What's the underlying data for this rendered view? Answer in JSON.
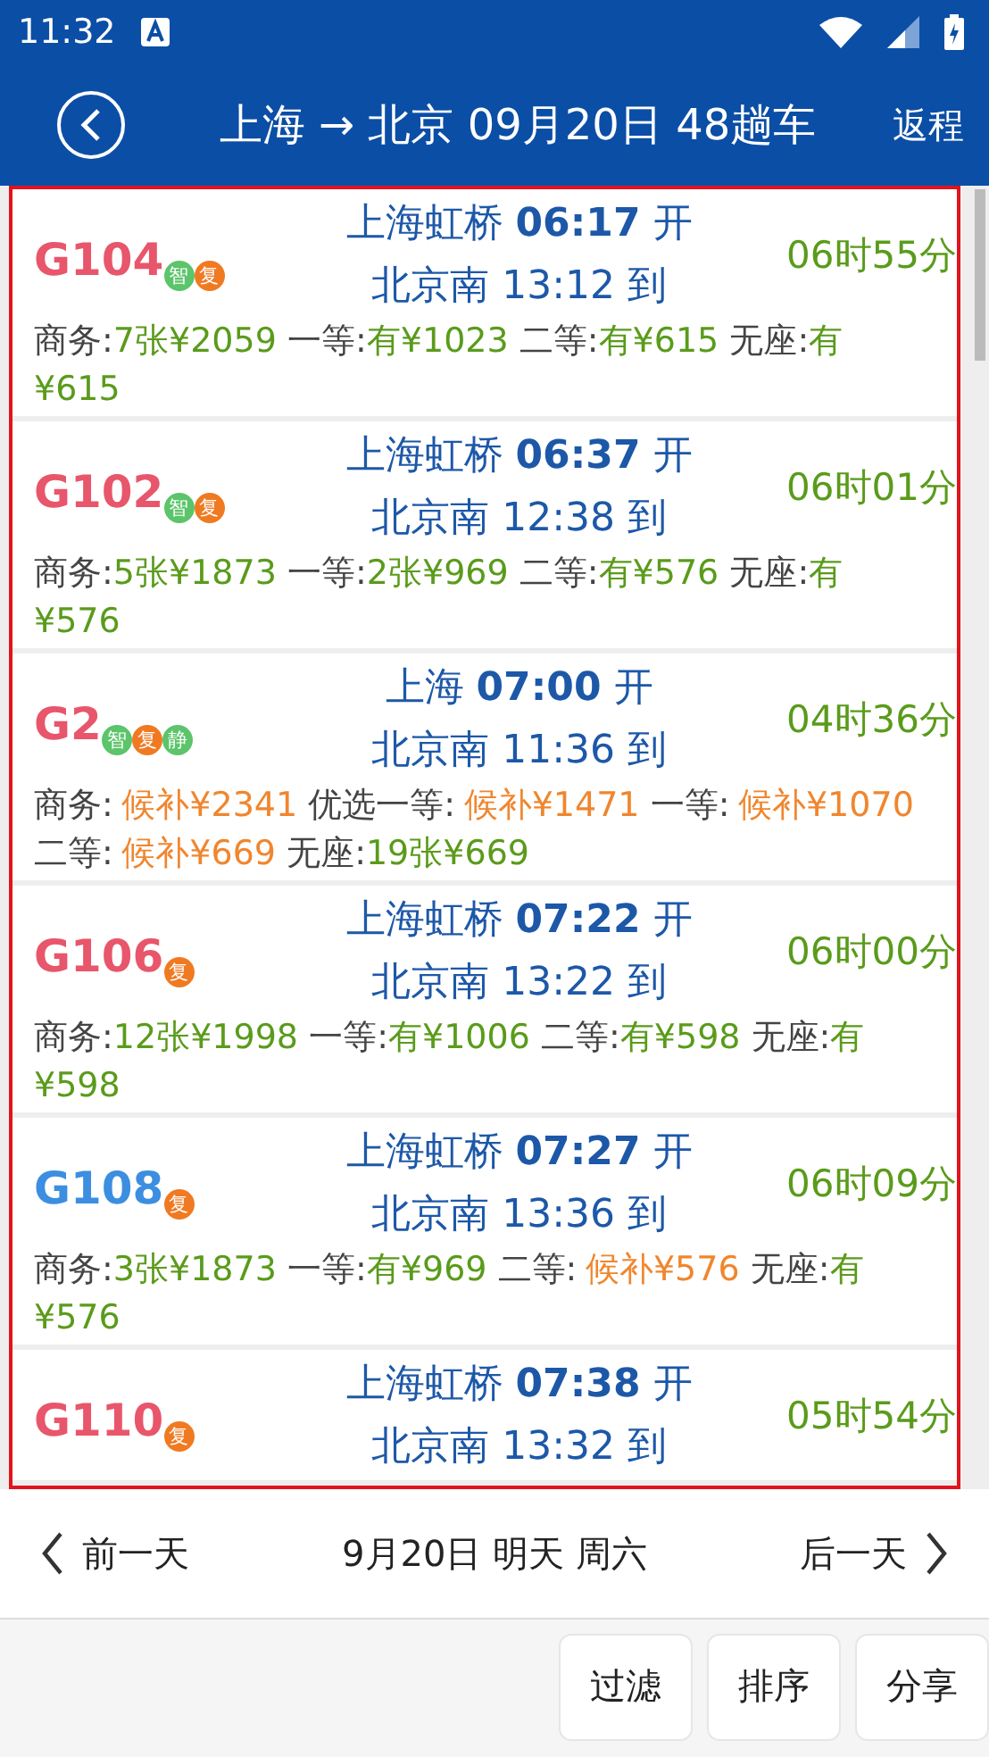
{
  "status_bar": {
    "time": "11:32"
  },
  "header": {
    "title": "上海 → 北京 09月20日 48趟车",
    "return_button": "返程"
  },
  "trains": [
    {
      "code": "G104",
      "color": "#e8566c",
      "badges": [
        {
          "label": "智",
          "color": "#5cc46a"
        },
        {
          "label": "复",
          "color": "#f07a22"
        }
      ],
      "depart": "上海虹桥 **06:17** 开",
      "arrive": "北京南 13:12 到",
      "duration": "06时55分",
      "seats": [
        {
          "label": "商务:",
          "value": "7张¥2059",
          "waitlist": false
        },
        {
          "label": "一等:",
          "value": "有¥1023",
          "waitlist": false
        },
        {
          "label": "二等:",
          "value": "有¥615",
          "waitlist": false
        },
        {
          "label": "无座:",
          "value": "有¥615",
          "waitlist": false
        }
      ]
    },
    {
      "code": "G102",
      "color": "#e8566c",
      "badges": [
        {
          "label": "智",
          "color": "#5cc46a"
        },
        {
          "label": "复",
          "color": "#f07a22"
        }
      ],
      "depart": "上海虹桥 **06:37** 开",
      "arrive": "北京南 12:38 到",
      "duration": "06时01分",
      "seats": [
        {
          "label": "商务:",
          "value": "5张¥1873",
          "waitlist": false
        },
        {
          "label": "一等:",
          "value": "2张¥969",
          "waitlist": false
        },
        {
          "label": "二等:",
          "value": "有¥576",
          "waitlist": false
        },
        {
          "label": "无座:",
          "value": "有¥576",
          "waitlist": false
        }
      ]
    },
    {
      "code": "G2",
      "color": "#e8566c",
      "badges": [
        {
          "label": "智",
          "color": "#5cc46a"
        },
        {
          "label": "复",
          "color": "#f07a22"
        },
        {
          "label": "静",
          "color": "#5cc46a"
        }
      ],
      "depart": "上海 **07:00** 开",
      "arrive": "北京南 11:36 到",
      "duration": "04时36分",
      "seats": [
        {
          "label": "商务:",
          "value": "候补¥2341",
          "waitlist": true
        },
        {
          "label": "优选一等:",
          "value": "候补¥1471",
          "waitlist": true
        },
        {
          "label": "一等:",
          "value": "候补¥1070",
          "waitlist": true
        },
        {
          "label": "二等:",
          "value": "候补¥669",
          "waitlist": true
        },
        {
          "label": "无座:",
          "value": "19张¥669",
          "waitlist": false
        }
      ]
    },
    {
      "code": "G106",
      "color": "#e8566c",
      "badges": [
        {
          "label": "复",
          "color": "#f07a22"
        }
      ],
      "depart": "上海虹桥 **07:22** 开",
      "arrive": "北京南 13:22 到",
      "duration": "06时00分",
      "seats": [
        {
          "label": "商务:",
          "value": "12张¥1998",
          "waitlist": false
        },
        {
          "label": "一等:",
          "value": "有¥1006",
          "waitlist": false
        },
        {
          "label": "二等:",
          "value": "有¥598",
          "waitlist": false
        },
        {
          "label": "无座:",
          "value": "有¥598",
          "waitlist": false
        }
      ]
    },
    {
      "code": "G108",
      "color": "#3c8ee0",
      "badges": [
        {
          "label": "复",
          "color": "#f07a22"
        }
      ],
      "depart": "上海虹桥 **07:27** 开",
      "arrive": "北京南 13:36 到",
      "duration": "06时09分",
      "seats": [
        {
          "label": "商务:",
          "value": "3张¥1873",
          "waitlist": false
        },
        {
          "label": "一等:",
          "value": "有¥969",
          "waitlist": false
        },
        {
          "label": "二等:",
          "value": "候补¥576",
          "waitlist": true
        },
        {
          "label": "无座:",
          "value": "有¥576",
          "waitlist": false
        }
      ]
    },
    {
      "code": "G110",
      "color": "#e8566c",
      "badges": [
        {
          "label": "复",
          "color": "#f07a22"
        }
      ],
      "depart": "上海虹桥 **07:38** 开",
      "arrive": "北京南 13:32 到",
      "duration": "05时54分"
    }
  ],
  "date_bar": {
    "prev": "前一天",
    "date": "9月20日 明天 周六",
    "next": "后一天"
  },
  "actions": [
    "过滤",
    "排序",
    "分享"
  ]
}
